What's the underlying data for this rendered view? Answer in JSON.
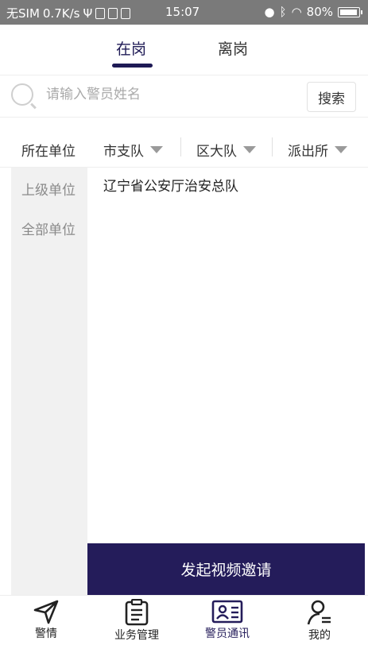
{
  "status_bar": {
    "carrier": "无SIM",
    "speed": "0.7K/s",
    "time": "15:07",
    "battery": "80%"
  },
  "tabs": [
    {
      "label": "在岗",
      "active": true
    },
    {
      "label": "离岗",
      "active": false
    }
  ],
  "search": {
    "placeholder": "请输入警员姓名",
    "button": "搜索"
  },
  "filters": {
    "label": "所在单位",
    "dropdowns": [
      "市支队",
      "区大队",
      "派出所"
    ]
  },
  "sidebar": {
    "items": [
      "上级单位",
      "全部单位"
    ]
  },
  "content": {
    "items": [
      "辽宁省公安厅治安总队"
    ]
  },
  "action": {
    "invite_button": "发起视频邀请"
  },
  "bottom_nav": [
    {
      "label": "警情",
      "icon": "send-icon",
      "active": false
    },
    {
      "label": "业务管理",
      "icon": "clipboard-icon",
      "active": false
    },
    {
      "label": "警员通讯",
      "icon": "id-card-icon",
      "active": true
    },
    {
      "label": "我的",
      "icon": "person-icon",
      "active": false
    }
  ],
  "colors": {
    "primary": "#241c5a",
    "status_bar": "#7a7a7a",
    "sidebar_bg": "#f1f1f1"
  }
}
